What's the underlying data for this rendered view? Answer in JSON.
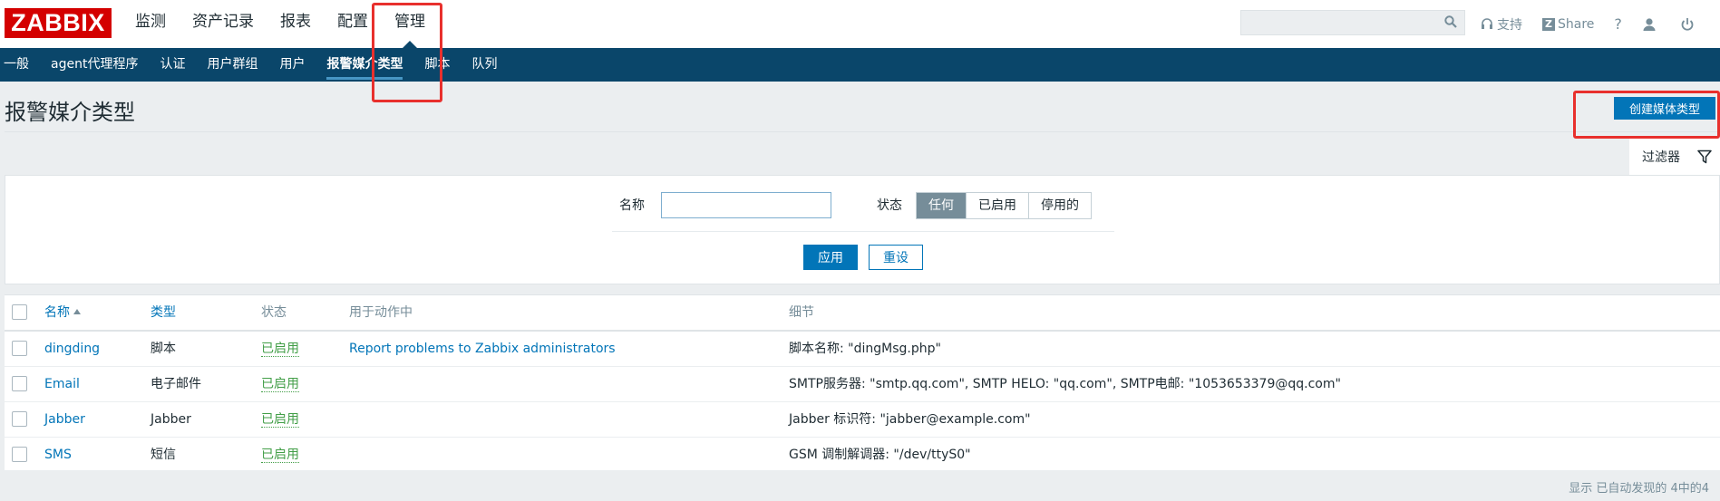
{
  "app": {
    "logo": "ZABBIX"
  },
  "main_menu": [
    {
      "label": "监测"
    },
    {
      "label": "资产记录"
    },
    {
      "label": "报表"
    },
    {
      "label": "配置"
    },
    {
      "label": "管理"
    }
  ],
  "top_actions": {
    "search_placeholder": "",
    "support": "支持",
    "share": "Share",
    "help": "?"
  },
  "sub_menu": [
    {
      "label": "一般"
    },
    {
      "label": "agent代理程序"
    },
    {
      "label": "认证"
    },
    {
      "label": "用户群组"
    },
    {
      "label": "用户"
    },
    {
      "label": "报警媒介类型"
    },
    {
      "label": "脚本"
    },
    {
      "label": "队列"
    }
  ],
  "page": {
    "title": "报警媒介类型",
    "create_button": "创建媒体类型",
    "filter_tab": "过滤器"
  },
  "filter": {
    "name_label": "名称",
    "name_value": "",
    "status_label": "状态",
    "status_options": [
      "任何",
      "已启用",
      "停用的"
    ],
    "status_selected": "任何",
    "apply": "应用",
    "reset": "重设"
  },
  "table": {
    "headers": {
      "name": "名称",
      "type": "类型",
      "status": "状态",
      "used_in": "用于动作中",
      "details": "细节"
    },
    "rows": [
      {
        "name": "dingding",
        "type": "脚本",
        "status": "已启用",
        "used_in": "Report problems to Zabbix administrators",
        "details": "脚本名称: \"dingMsg.php\""
      },
      {
        "name": "Email",
        "type": "电子邮件",
        "status": "已启用",
        "used_in": "",
        "details": "SMTP服务器: \"smtp.qq.com\", SMTP HELO: \"qq.com\", SMTP电邮: \"1053653379@qq.com\""
      },
      {
        "name": "Jabber",
        "type": "Jabber",
        "status": "已启用",
        "used_in": "",
        "details": "Jabber 标识符: \"jabber@example.com\""
      },
      {
        "name": "SMS",
        "type": "短信",
        "status": "已启用",
        "used_in": "",
        "details": "GSM 调制解调器: \"/dev/ttyS0\""
      }
    ],
    "footer": "显示 已自动发现的 4中的4"
  },
  "colors": {
    "brand_red": "#d40000",
    "nav_blue": "#0a466a",
    "primary_button": "#0275b8",
    "enabled_green": "#429e47",
    "annotation_red": "#e8302d"
  }
}
